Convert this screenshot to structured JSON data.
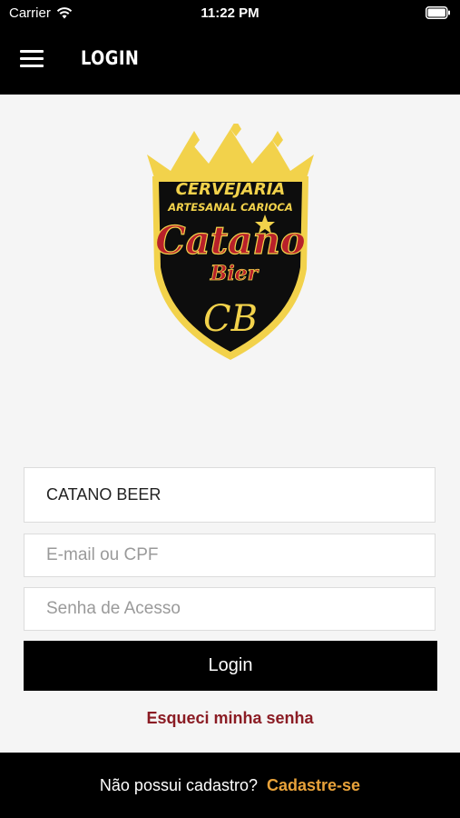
{
  "status_bar": {
    "carrier": "Carrier",
    "time": "11:22 PM"
  },
  "nav": {
    "title": "LOGIN"
  },
  "logo": {
    "line1": "CERVEJARIA",
    "line2": "ARTESANAL CARIOCA",
    "brand": "Catano",
    "brand2": "Bier",
    "monogram": "CB"
  },
  "form": {
    "store_value": "CATANO BEER",
    "email_placeholder": "E-mail ou CPF",
    "password_placeholder": "Senha de Acesso",
    "login_label": "Login",
    "forgot_label": "Esqueci minha senha"
  },
  "footer": {
    "question": "Não possui cadastro?",
    "signup_label": "Cadastre-se"
  },
  "colors": {
    "accent_red": "#8b1c24",
    "accent_orange": "#e8a23a",
    "gold": "#f2d24b"
  }
}
